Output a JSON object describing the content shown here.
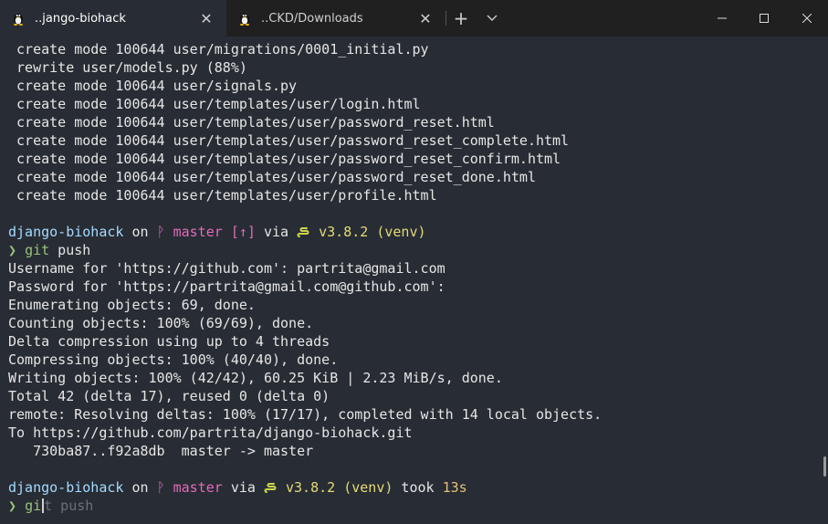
{
  "tabs": [
    {
      "title": "..jango-biohack",
      "icon": "linux-tux-icon",
      "active": true
    },
    {
      "title": "..CKD/Downloads",
      "icon": "linux-tux-icon",
      "active": false
    }
  ],
  "titlebar": {
    "new_tab": "+",
    "dropdown": "chevron-down-icon"
  },
  "window_controls": {
    "minimize": "─",
    "maximize": "☐",
    "close": "✕"
  },
  "terminal": {
    "commit_lines": [
      " create mode 100644 user/migrations/0001_initial.py",
      " rewrite user/models.py (88%)",
      " create mode 100644 user/signals.py",
      " create mode 100644 user/templates/user/login.html",
      " create mode 100644 user/templates/user/password_reset.html",
      " create mode 100644 user/templates/user/password_reset_complete.html",
      " create mode 100644 user/templates/user/password_reset_confirm.html",
      " create mode 100644 user/templates/user/password_reset_done.html",
      " create mode 100644 user/templates/user/profile.html"
    ],
    "prompt1": {
      "dir": "django-biohack",
      "on": " on ",
      "branch_glyph": "ᚹ",
      "branch": " master",
      "ahead": " [↑]",
      "via": " via ",
      "python": " v3.8.2",
      "venv": " (venv)"
    },
    "cmd1": {
      "caret": "❯ ",
      "command": "git",
      "args": " push"
    },
    "output_lines": [
      "Username for 'https://github.com': partrita@gmail.com",
      "Password for 'https://partrita@gmail.com@github.com':",
      "Enumerating objects: 69, done.",
      "Counting objects: 100% (69/69), done.",
      "Delta compression using up to 4 threads",
      "Compressing objects: 100% (40/40), done.",
      "Writing objects: 100% (42/42), 60.25 KiB | 2.23 MiB/s, done.",
      "Total 42 (delta 17), reused 0 (delta 0)",
      "remote: Resolving deltas: 100% (17/17), completed with 14 local objects.",
      "To https://github.com/partrita/django-biohack.git",
      "   730ba87..f92a8db  master -> master"
    ],
    "prompt2": {
      "dir": "django-biohack",
      "on": " on ",
      "branch_glyph": "ᚹ",
      "branch": " master",
      "via": " via ",
      "python": " v3.8.2",
      "venv": " (venv)",
      "took": " took ",
      "duration": "13s"
    },
    "cmd2": {
      "caret": "❯ ",
      "typed": "gi",
      "typed_tail": "t",
      "suggestion": " push"
    }
  }
}
